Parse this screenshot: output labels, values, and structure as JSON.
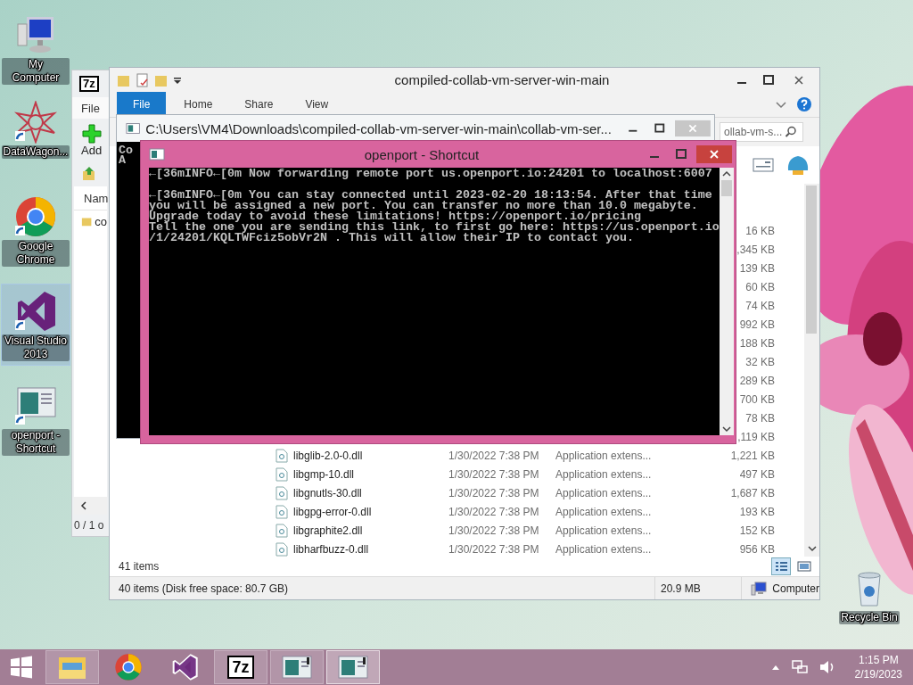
{
  "desktop_icons": [
    {
      "kind": "computer",
      "label": "My Computer",
      "selected": false
    },
    {
      "kind": "star",
      "label": "DataWagon...",
      "selected": false
    },
    {
      "kind": "chrome",
      "label": "Google Chrome",
      "selected": false
    },
    {
      "kind": "studio",
      "label": "Visual Studio 2013",
      "selected": true
    },
    {
      "kind": "console",
      "label": "openport - Shortcut",
      "selected": false
    }
  ],
  "recycle_bin": {
    "label": "Recycle Bin"
  },
  "archiver_window": {
    "logo": "7z",
    "menu": [
      "File"
    ],
    "toolbar": [
      "Add"
    ],
    "column": "Nam",
    "rows": [
      "co"
    ],
    "status": "0 / 1 o"
  },
  "explorer_window": {
    "title": "compiled-collab-vm-server-win-main",
    "tabs": [
      {
        "label": "File",
        "selected": true
      },
      {
        "label": "Home",
        "selected": false
      },
      {
        "label": "Share",
        "selected": false
      },
      {
        "label": "View",
        "selected": false
      }
    ],
    "address_tail": "ollab-vm-s...",
    "files": [
      {
        "size": "16 KB"
      },
      {
        "size": ",345 KB"
      },
      {
        "size": "139 KB"
      },
      {
        "size": "60 KB"
      },
      {
        "size": "74 KB"
      },
      {
        "size": "992 KB"
      },
      {
        "size": "188 KB"
      },
      {
        "size": "32 KB"
      },
      {
        "size": "289 KB"
      },
      {
        "size": "700 KB"
      },
      {
        "size": "78 KB"
      },
      {
        "size": ",119 KB"
      },
      {
        "name": "libglib-2.0-0.dll",
        "date": "1/30/2022 7:38 PM",
        "type": "Application extens...",
        "size": "1,221 KB"
      },
      {
        "name": "libgmp-10.dll",
        "date": "1/30/2022 7:38 PM",
        "type": "Application extens...",
        "size": "497 KB"
      },
      {
        "name": "libgnutls-30.dll",
        "date": "1/30/2022 7:38 PM",
        "type": "Application extens...",
        "size": "1,687 KB"
      },
      {
        "name": "libgpg-error-0.dll",
        "date": "1/30/2022 7:38 PM",
        "type": "Application extens...",
        "size": "193 KB"
      },
      {
        "name": "libgraphite2.dll",
        "date": "1/30/2022 7:38 PM",
        "type": "Application extens...",
        "size": "152 KB"
      },
      {
        "name": "libharfbuzz-0.dll",
        "date": "1/30/2022 7:38 PM",
        "type": "Application extens...",
        "size": "956 KB"
      }
    ],
    "item_count": "41 items",
    "status_bar": [
      {
        "kind": "plain",
        "text": "40 items (Disk free space: 80.7 GB)"
      },
      {
        "kind": "plain",
        "text": "20.9 MB"
      },
      {
        "kind": "computer",
        "text": "Computer"
      }
    ]
  },
  "console_window": {
    "title": "C:\\Users\\VM4\\Downloads\\compiled-collab-vm-server-win-main\\collab-vm-ser...",
    "lines": [
      "Co",
      "A"
    ]
  },
  "openport_window": {
    "title": "openport - Shortcut",
    "paragraphs": [
      [
        "←[36mINFO←[0m Now forwarding remote port us.openport.io:24201 to localhost:6007"
      ],
      [
        "←[36mINFO←[0m You can stay connected until 2023-02-20 18:13:54. After that time",
        "you will be assigned a new port. You can transfer no more than 10.0 megabyte.",
        "Upgrade today to avoid these limitations! https://openport.io/pricing",
        "Tell the one you are sending this link, to first go here: https://us.openport.io",
        "/1/24201/KQLTWFciz5obVr2N . This will allow their IP to contact you."
      ]
    ]
  },
  "taskbar": {
    "items": [
      {
        "kind": "start",
        "running": false,
        "selected": false
      },
      {
        "kind": "explorer",
        "running": true,
        "selected": false
      },
      {
        "kind": "chrome",
        "running": false,
        "selected": false
      },
      {
        "kind": "studio",
        "running": false,
        "selected": false
      },
      {
        "kind": "archiver",
        "label": "7z",
        "running": true,
        "selected": false
      },
      {
        "kind": "console",
        "running": true,
        "selected": false
      },
      {
        "kind": "console",
        "running": true,
        "selected": true
      }
    ],
    "time": "1:15 PM",
    "date": "2/19/2023"
  }
}
